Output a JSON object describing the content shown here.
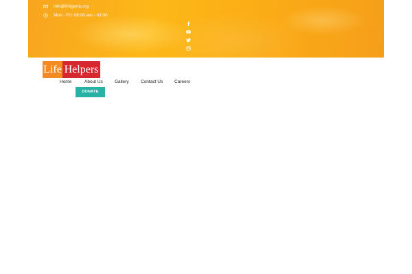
{
  "topbar": {
    "email": "info@lfnigeria.org",
    "hours": "Mon - Fri: 08:00 am - 03:00",
    "icons": [
      "envelope-icon",
      "clock-icon"
    ],
    "social_icons": [
      "facebook-icon",
      "youtube-icon",
      "twitter-icon",
      "instagram-icon"
    ],
    "colors": {
      "background": "#fbae15",
      "text": "#ffffff"
    }
  },
  "logo": {
    "left": "Life",
    "right": "Helpers"
  },
  "nav": {
    "items": [
      "Home",
      "About Us",
      "Gallery",
      "Contact Us",
      "Careers"
    ]
  },
  "donate": {
    "label": "DONATE",
    "color": "#28b2a5"
  }
}
